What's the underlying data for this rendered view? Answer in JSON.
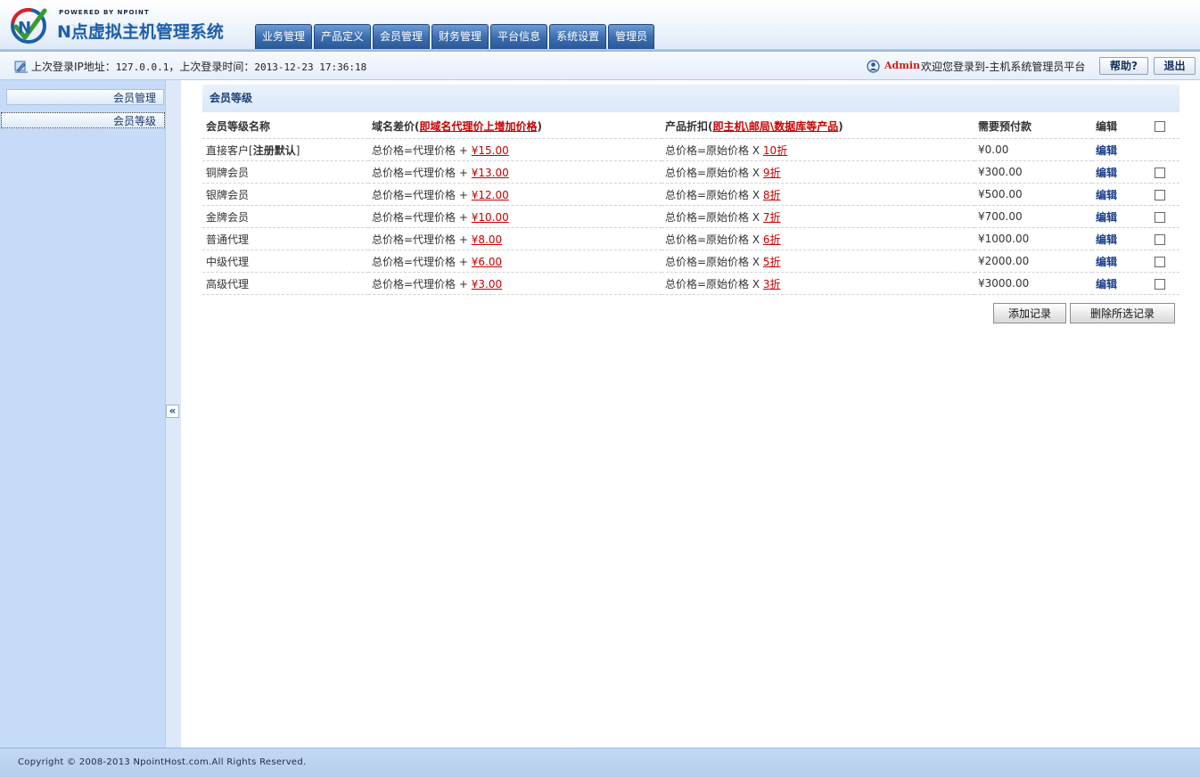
{
  "brand": {
    "powered_by": "POWERED BY NPOINT",
    "title": "N点虚拟主机管理系统"
  },
  "nav": {
    "tabs": [
      "业务管理",
      "产品定义",
      "会员管理",
      "财务管理",
      "平台信息",
      "系统设置",
      "管理员"
    ]
  },
  "infobar": {
    "last_login_ip_label": "上次登录IP地址：",
    "last_login_ip": "127.0.0.1",
    "separator": "，",
    "last_login_time_label": "上次登录时间：",
    "last_login_time": "2013-12-23 17:36:18",
    "user_name": "Admin",
    "welcome": "欢迎您登录到-主机系统管理员平台",
    "help_label": "帮助?",
    "logout_label": "退出"
  },
  "sidebar": {
    "items": [
      {
        "label": "会员管理"
      },
      {
        "label": "会员等级"
      }
    ],
    "collapse_glyph": "«"
  },
  "main": {
    "panel_title": "会员等级",
    "columns": {
      "name": "会员等级名称",
      "domain_prefix": "域名差价(",
      "domain_note": "即域名代理价上增加价格",
      "domain_suffix": ")",
      "product_prefix": "产品折扣(",
      "product_note": "即主机\\邮局\\数据库等产品",
      "product_suffix": ")",
      "prepay": "需要预付款",
      "edit": "编辑"
    },
    "formula_domain": "总价格=代理价格 +",
    "formula_product": "总价格=原始价格 X",
    "rows": [
      {
        "name": "直接客户[",
        "name_bold": "注册默认",
        "name_tail": "]",
        "domain_price": "¥15.00",
        "discount": "10折",
        "prepay": "¥0.00",
        "edit": "编辑",
        "checkbox": false
      },
      {
        "name": "铜牌会员",
        "name_bold": "",
        "name_tail": "",
        "domain_price": "¥13.00",
        "discount": "9折",
        "prepay": "¥300.00",
        "edit": "编辑",
        "checkbox": true
      },
      {
        "name": "银牌会员",
        "name_bold": "",
        "name_tail": "",
        "domain_price": "¥12.00",
        "discount": "8折",
        "prepay": "¥500.00",
        "edit": "编辑",
        "checkbox": true
      },
      {
        "name": "金牌会员",
        "name_bold": "",
        "name_tail": "",
        "domain_price": "¥10.00",
        "discount": "7折",
        "prepay": "¥700.00",
        "edit": "编辑",
        "checkbox": true
      },
      {
        "name": "普通代理",
        "name_bold": "",
        "name_tail": "",
        "domain_price": "¥8.00",
        "discount": "6折",
        "prepay": "¥1000.00",
        "edit": "编辑",
        "checkbox": true
      },
      {
        "name": "中级代理",
        "name_bold": "",
        "name_tail": "",
        "domain_price": "¥6.00",
        "discount": "5折",
        "prepay": "¥2000.00",
        "edit": "编辑",
        "checkbox": true
      },
      {
        "name": "高级代理",
        "name_bold": "",
        "name_tail": "",
        "domain_price": "¥3.00",
        "discount": "3折",
        "prepay": "¥3000.00",
        "edit": "编辑",
        "checkbox": true
      }
    ],
    "add_button": "添加记录",
    "delete_button": "删除所选记录"
  },
  "footer": {
    "copyright": "Copyright © 2008-2013 NpointHost.com.All Rights Reserved."
  },
  "colors": {
    "accent": "#2a5896",
    "sidebar_bg": "#c5dbf7",
    "price_red": "#c80000"
  }
}
